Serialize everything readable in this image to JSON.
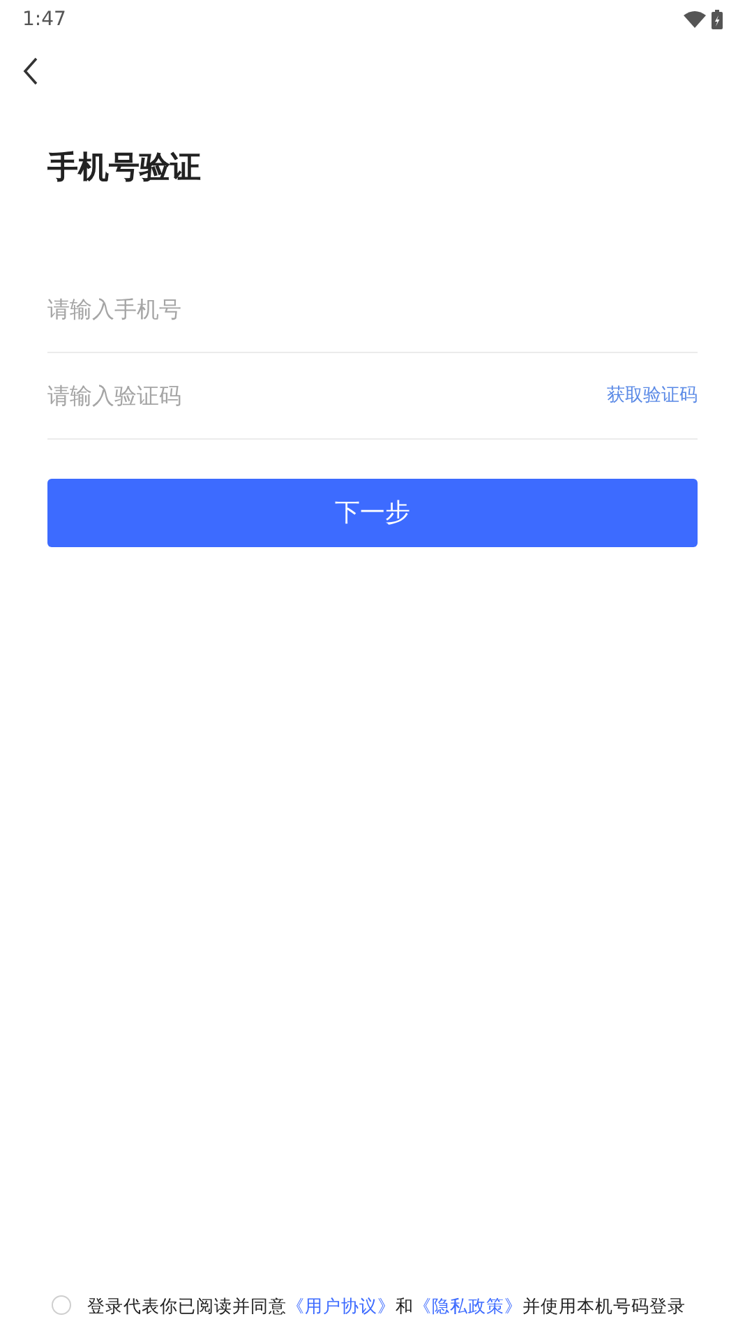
{
  "status_bar": {
    "time": "1:47"
  },
  "title": "手机号验证",
  "phone_field": {
    "placeholder": "请输入手机号"
  },
  "code_field": {
    "placeholder": "请输入验证码",
    "action": "获取验证码"
  },
  "next_button": "下一步",
  "agreement": {
    "checked": false,
    "parts": [
      {
        "kind": "text",
        "text": "登录代表你已阅读并同意"
      },
      {
        "kind": "link",
        "text": "《用户协议》"
      },
      {
        "kind": "text",
        "text": "和"
      },
      {
        "kind": "link",
        "text": "《隐私政策》"
      },
      {
        "kind": "text",
        "text": "并使用本机号码登录"
      }
    ]
  }
}
